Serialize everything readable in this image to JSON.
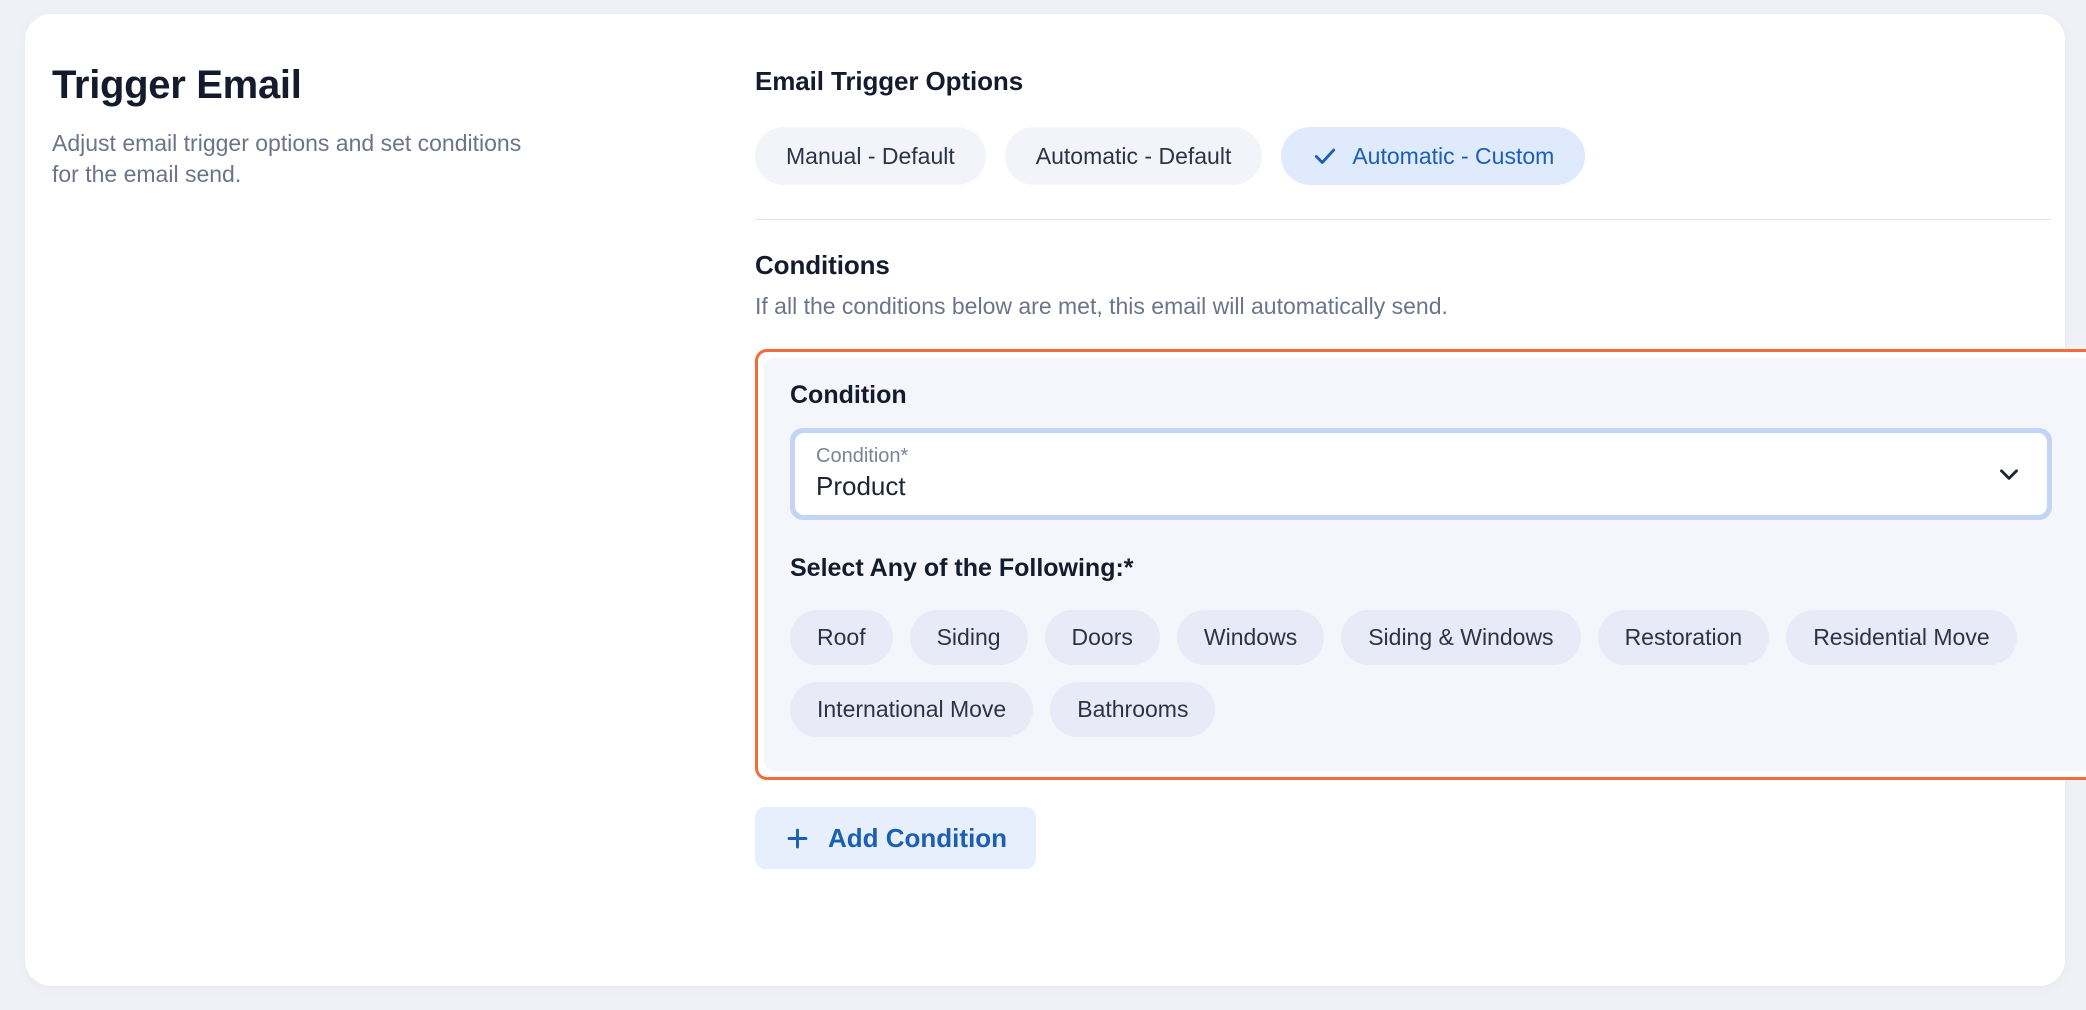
{
  "panel": {
    "title": "Trigger Email",
    "subtitle": "Adjust email trigger options and set conditions for the email send."
  },
  "trigger_options": {
    "heading": "Email Trigger Options",
    "options": [
      {
        "label": "Manual - Default",
        "selected": false
      },
      {
        "label": "Automatic - Default",
        "selected": false
      },
      {
        "label": "Automatic - Custom",
        "selected": true
      }
    ]
  },
  "conditions": {
    "heading": "Conditions",
    "description": "If all the conditions below are met, this email will automatically send.",
    "card": {
      "title": "Condition",
      "select": {
        "label": "Condition*",
        "value": "Product",
        "chevron_icon": "chevron-down-icon"
      },
      "chips_label": "Select Any of the Following:*",
      "chips": [
        "Roof",
        "Siding",
        "Doors",
        "Windows",
        "Siding & Windows",
        "Restoration",
        "Residential Move",
        "International Move",
        "Bathrooms"
      ]
    },
    "add_button": {
      "label": "Add Condition",
      "icon": "plus-icon"
    }
  },
  "colors": {
    "page_background": "#eff1f6",
    "card_background": "#ffffff",
    "accent_blue": "#1a5fb4",
    "selected_pill_background": "#dfeafc",
    "pill_background": "#f2f4f9",
    "chip_background": "#e8eaf7",
    "highlight_orange": "#f26b38",
    "focus_ring": "#c3d4f5",
    "condition_card_background": "#f4f6fb",
    "text_primary": "#141b2d",
    "text_muted": "#6b7489"
  }
}
